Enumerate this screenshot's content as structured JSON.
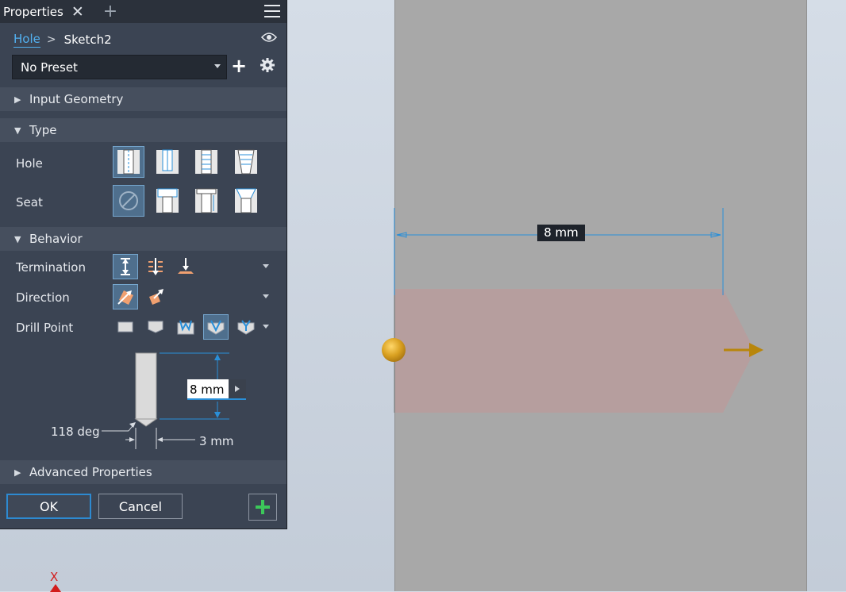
{
  "panel": {
    "title": "Properties",
    "breadcrumb": {
      "feature": "Hole",
      "sketch": "Sketch2"
    },
    "preset": {
      "value": "No Preset"
    },
    "sections": {
      "input_geometry": "Input Geometry",
      "type": "Type",
      "behavior": "Behavior",
      "advanced": "Advanced Properties"
    },
    "type": {
      "hole_label": "Hole",
      "seat_label": "Seat",
      "hole_options": [
        "simple-hole",
        "clearance-hole",
        "tapped-hole",
        "taper-tapped-hole"
      ],
      "hole_selected": "simple-hole",
      "seat_options": [
        "none",
        "counterbore",
        "spotface",
        "countersink"
      ],
      "seat_selected": "none"
    },
    "behavior": {
      "termination_label": "Termination",
      "direction_label": "Direction",
      "drill_point_label": "Drill Point",
      "termination_selected": "distance",
      "direction_selected": "default",
      "drill_point_selected": "angle-v"
    },
    "diagram": {
      "depth": "8 mm",
      "angle": "118 deg",
      "diameter": "3 mm"
    },
    "buttons": {
      "ok": "OK",
      "cancel": "Cancel"
    }
  },
  "viewport": {
    "dimension": "8 mm",
    "axis": "X"
  },
  "colors": {
    "panel_bg": "#3b4453",
    "accent_blue": "#2d8ad1",
    "selected_bg": "#4f6f8d",
    "preview_fill": "#b89c9c",
    "direction_arrow": "#b8860b",
    "apply_green": "#3cc85a"
  }
}
